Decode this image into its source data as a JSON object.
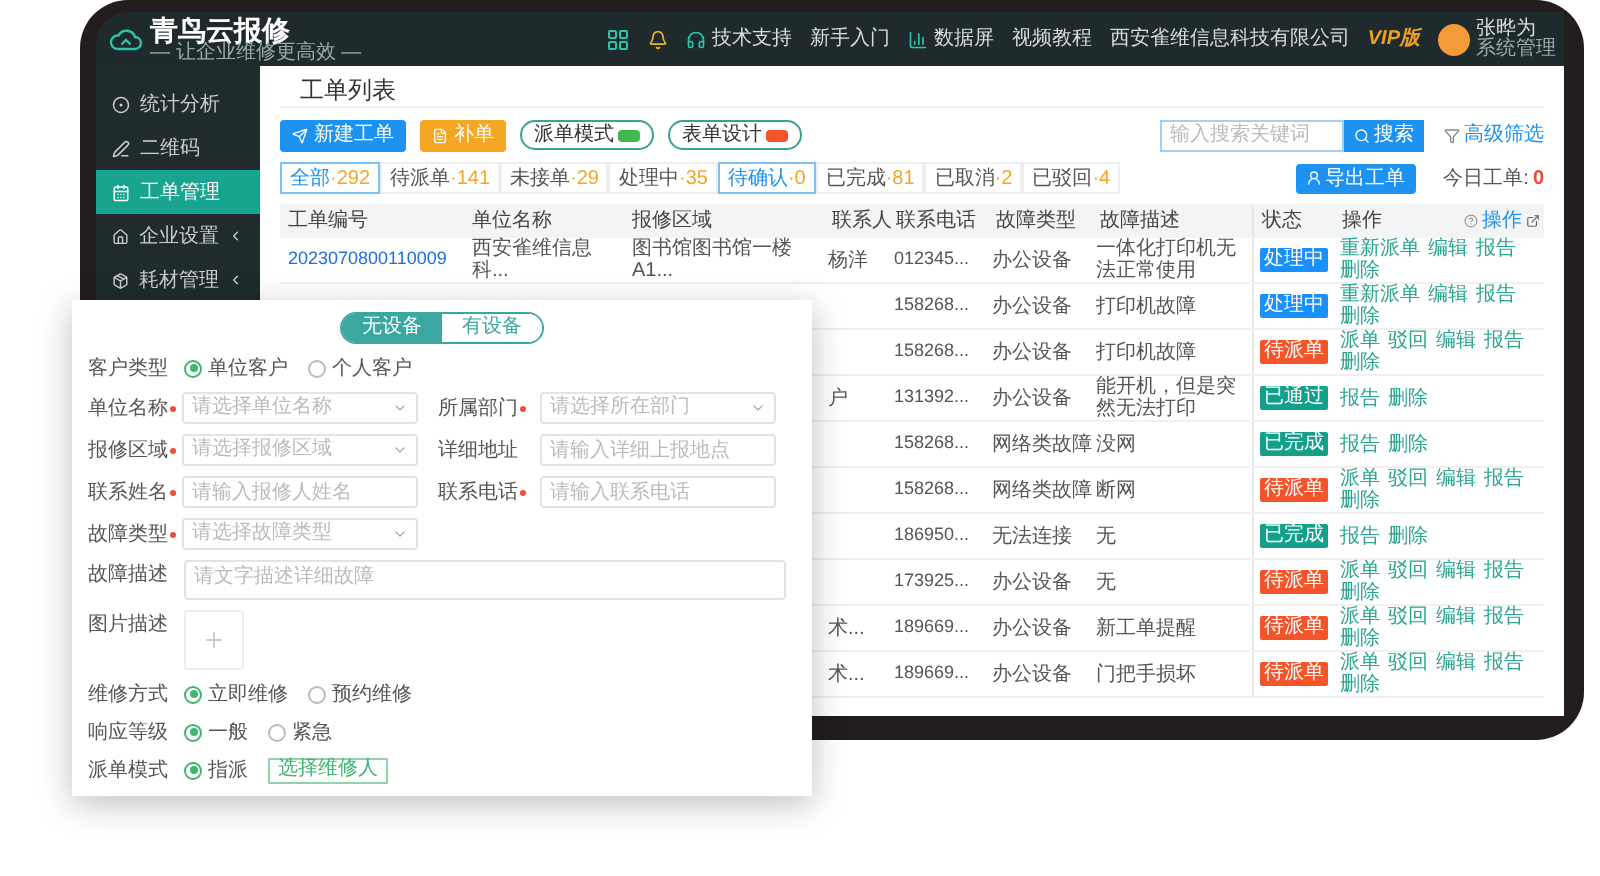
{
  "topbar": {
    "logo_title": "青鸟云报修",
    "logo_slogan": "— 让企业维修更高效 —",
    "links": [
      {
        "label": "技术支持",
        "kind": "support"
      },
      {
        "label": "新手入门",
        "kind": "plain"
      },
      {
        "label": "数据屏",
        "kind": "chart"
      },
      {
        "label": "视频教程",
        "kind": "plain"
      }
    ],
    "company": "西安雀维信息科技有限公司",
    "plan": "VIP版",
    "user_name": "张晔为",
    "user_role": "系统管理"
  },
  "sidebar": {
    "items": [
      {
        "label": "统计分析",
        "kind": "stats",
        "selected": false,
        "expandable": false
      },
      {
        "label": "二维码",
        "kind": "qrcode",
        "selected": false,
        "expandable": false
      },
      {
        "label": "工单管理",
        "kind": "orders",
        "selected": true,
        "expandable": false
      },
      {
        "label": "企业设置",
        "kind": "company",
        "selected": false,
        "expandable": true
      },
      {
        "label": "耗材管理",
        "kind": "supplies",
        "selected": false,
        "expandable": true
      }
    ]
  },
  "page_title": "工单列表",
  "toolbar": {
    "buttons": [
      {
        "label": "新建工单",
        "kind": "primary"
      },
      {
        "label": "补单",
        "kind": "warning"
      },
      {
        "label": "派单模式",
        "kind": "pill",
        "color": "#3fb950"
      },
      {
        "label": "表单设计",
        "kind": "pill",
        "color": "#f5542a"
      }
    ],
    "search": {
      "placeholder": "输入搜索关键词",
      "button": "搜索"
    },
    "filter": "高级筛选"
  },
  "tabs": [
    {
      "label": "全部",
      "count": "·292",
      "selected": true
    },
    {
      "label": "待派单",
      "count": "·141",
      "selected": false
    },
    {
      "label": "未接单",
      "count": "·29",
      "selected": false
    },
    {
      "label": "处理中",
      "count": "·35",
      "selected": false
    },
    {
      "label": "待确认",
      "count": "·0",
      "selected": true
    },
    {
      "label": "已完成",
      "count": "·81",
      "selected": false
    },
    {
      "label": "已取消",
      "count": "·2",
      "selected": false
    },
    {
      "label": "已驳回",
      "count": "·4",
      "selected": false
    }
  ],
  "export_button": "导出工单",
  "today_label": "今日工单:",
  "today_count": "0",
  "table": {
    "columns": [
      "工单编号",
      "单位名称",
      "报修区域",
      "联系人",
      "联系电话",
      "故障类型",
      "故障描述",
      "状态",
      "操作"
    ],
    "settings_label": "操作",
    "rows": [
      {
        "order_no": "2023070800110009",
        "unit": "西安雀维信息科...",
        "area": "图书馆图书馆一楼 A1...",
        "contact": "杨洋",
        "phone": "012345...",
        "fault_type": "办公设备",
        "description": "一体化打印机无法正常使用",
        "status": {
          "label": "处理中",
          "color": "#1890ff"
        },
        "actions": [
          "重新派单",
          "编辑",
          "报告",
          "删除"
        ]
      },
      {
        "phone": "158268...",
        "fault_type": "办公设备",
        "description": "打印机故障",
        "status": {
          "label": "处理中",
          "color": "#1890ff"
        },
        "actions": [
          "重新派单",
          "编辑",
          "报告",
          "删除"
        ]
      },
      {
        "phone": "158268...",
        "fault_type": "办公设备",
        "description": "打印机故障",
        "status": {
          "label": "待派单",
          "color": "#f5542a"
        },
        "actions": [
          "派单",
          "驳回",
          "编辑",
          "报告",
          "删除"
        ]
      },
      {
        "contact": "户",
        "phone": "131392...",
        "fault_type": "办公设备",
        "description": "能开机，但是突然无法打印",
        "status": {
          "label": "已通过",
          "color": "#13a08b"
        },
        "actions": [
          "报告",
          "删除"
        ]
      },
      {
        "phone": "158268...",
        "fault_type": "网络类故障",
        "description": "没网",
        "status": {
          "label": "已完成",
          "color": "#13a08b"
        },
        "actions": [
          "报告",
          "删除"
        ]
      },
      {
        "phone": "158268...",
        "fault_type": "网络类故障",
        "description": "断网",
        "status": {
          "label": "待派单",
          "color": "#f5542a"
        },
        "actions": [
          "派单",
          "驳回",
          "编辑",
          "报告",
          "删除"
        ]
      },
      {
        "phone": "186950...",
        "fault_type": "无法连接",
        "description": "无",
        "status": {
          "label": "已完成",
          "color": "#13a08b"
        },
        "actions": [
          "报告",
          "删除"
        ]
      },
      {
        "phone": "173925...",
        "fault_type": "办公设备",
        "description": "无",
        "status": {
          "label": "待派单",
          "color": "#f5542a"
        },
        "actions": [
          "派单",
          "驳回",
          "编辑",
          "报告",
          "删除"
        ]
      },
      {
        "contact": "术...",
        "phone": "189669...",
        "fault_type": "办公设备",
        "description": "新工单提醒",
        "status": {
          "label": "待派单",
          "color": "#f5542a"
        },
        "actions": [
          "派单",
          "驳回",
          "编辑",
          "报告",
          "删除"
        ]
      },
      {
        "contact": "术...",
        "phone": "189669...",
        "fault_type": "办公设备",
        "description": "门把手损坏",
        "status": {
          "label": "待派单",
          "color": "#f5542a"
        },
        "actions": [
          "派单",
          "驳回",
          "编辑",
          "报告",
          "删除"
        ]
      }
    ]
  },
  "form": {
    "mode_toggle": [
      {
        "label": "无设备",
        "selected": true
      },
      {
        "label": "有设备",
        "selected": false
      }
    ],
    "rows": [
      {
        "kind": "radio",
        "label": "客户类型",
        "options": [
          {
            "label": "单位客户",
            "checked": true
          },
          {
            "label": "个人客户",
            "checked": false
          }
        ]
      },
      {
        "kind": "fields",
        "fields": [
          {
            "label": "单位名称",
            "required": true,
            "kind": "select",
            "placeholder": "请选择单位名称"
          },
          {
            "label": "所属部门",
            "required": true,
            "kind": "select",
            "placeholder": "请选择所在部门"
          }
        ]
      },
      {
        "kind": "fields",
        "fields": [
          {
            "label": "报修区域",
            "required": true,
            "kind": "select",
            "placeholder": "请选择报修区域"
          },
          {
            "label": "详细地址",
            "required": false,
            "kind": "input",
            "placeholder": "请输入详细上报地点"
          }
        ]
      },
      {
        "kind": "fields",
        "fields": [
          {
            "label": "联系姓名",
            "required": true,
            "kind": "input",
            "placeholder": "请输入报修人姓名"
          },
          {
            "label": "联系电话",
            "required": true,
            "kind": "input",
            "placeholder": "请输入联系电话"
          }
        ]
      },
      {
        "kind": "fields",
        "fields": [
          {
            "label": "故障类型",
            "required": true,
            "kind": "select",
            "placeholder": "请选择故障类型"
          }
        ]
      },
      {
        "kind": "textarea",
        "label": "故障描述",
        "placeholder": "请文字描述详细故障"
      },
      {
        "kind": "upload",
        "label": "图片描述"
      },
      {
        "kind": "radio",
        "label": "维修方式",
        "options": [
          {
            "label": "立即维修",
            "checked": true
          },
          {
            "label": "预约维修",
            "checked": false
          }
        ]
      },
      {
        "kind": "radio",
        "label": "响应等级",
        "options": [
          {
            "label": "一般",
            "checked": true
          },
          {
            "label": "紧急",
            "checked": false
          }
        ]
      },
      {
        "kind": "radio",
        "label": "派单模式",
        "options": [
          {
            "label": "指派",
            "checked": true
          }
        ],
        "action": "选择维修人"
      }
    ]
  }
}
